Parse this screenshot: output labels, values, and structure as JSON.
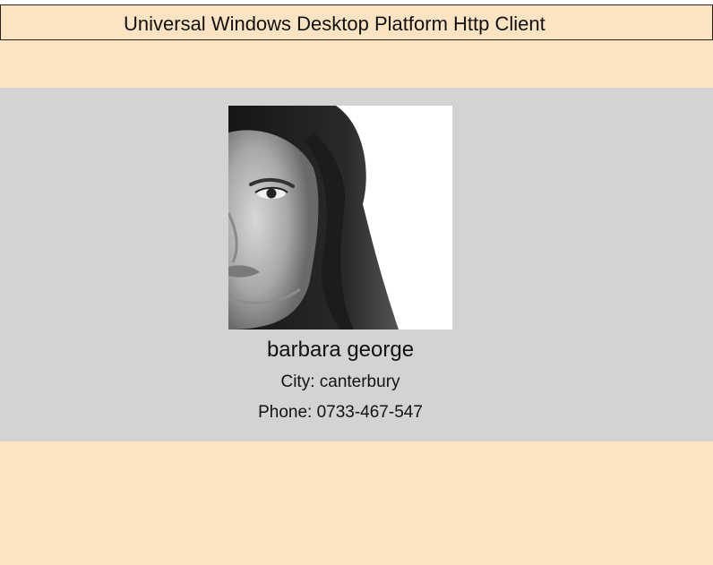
{
  "app": {
    "title": "Universal Windows Desktop Platform Http Client"
  },
  "contact": {
    "name": "barbara george",
    "city_label": "City: canterbury",
    "phone_label": "Phone: 0733-467-547",
    "photo": "portrait-photo"
  },
  "colors": {
    "page_background": "#fce4c3",
    "card_background": "#d3d3d3",
    "border": "#222222"
  }
}
